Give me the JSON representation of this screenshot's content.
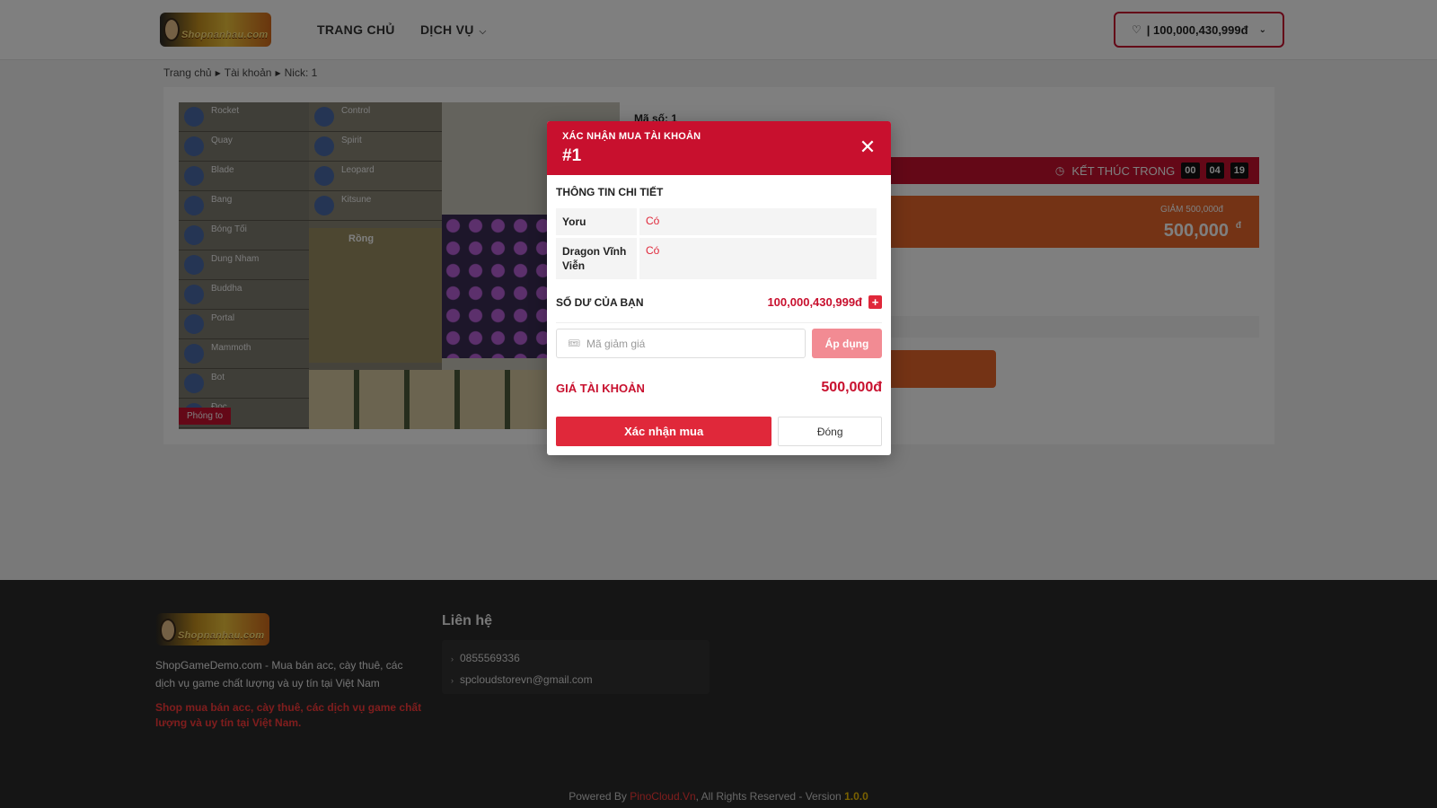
{
  "header": {
    "logo_text": "Shopnanhau.com",
    "nav": {
      "home": "TRANG CHỦ",
      "services": "DỊCH VỤ"
    },
    "balance": "| 100,000,430,999đ"
  },
  "breadcrumb": [
    "Trang chủ",
    "Tài khoản",
    "Nick: 1"
  ],
  "product": {
    "code_label": "Mã số: 1",
    "zoom_label": "Phóng to",
    "thumb_names_a": [
      "Rocket",
      "Quay",
      "Blade",
      "Bang",
      "Bóng Tối",
      "Dung Nham",
      "Buddha",
      "Portal",
      "Mammoth",
      "Bot",
      "Đọc"
    ],
    "thumb_names_b": [
      "Control",
      "Spirit",
      "Leopard",
      "Kitsune"
    ],
    "scene_label": "Rồng",
    "timer": {
      "label": "KẾT THÚC TRONG",
      "h": "00",
      "m": "04",
      "s": "19"
    },
    "discount_label": "GIẢM 500,000đ",
    "price": "500,000",
    "price_currency": "đ"
  },
  "modal": {
    "title": "XÁC NHẬN MUA TÀI KHOẢN",
    "number": "#1",
    "details_title": "THÔNG TIN CHI TIẾT",
    "details": [
      {
        "key": "Yoru",
        "value": "Có"
      },
      {
        "key": "Dragon Vĩnh Viễn",
        "value": "Có"
      }
    ],
    "balance_label": "SỐ DƯ CỦA BẠN",
    "balance_value": "100,000,430,999đ",
    "coupon_placeholder": "Mã giảm giá",
    "apply_label": "Áp dụng",
    "price_label": "GIÁ TÀI KHOẢN",
    "price_value": "500,000đ",
    "confirm_label": "Xác nhận mua",
    "close_label": "Đóng"
  },
  "footer": {
    "description": "ShopGameDemo.com - Mua bán acc, cày thuê, các dịch vụ game chất lượng và uy tín tại Việt Nam",
    "tagline": "Shop mua bán acc, cày thuê, các dịch vụ game chất lượng và uy tín tại Việt Nam.",
    "contact_title": "Liên hệ",
    "phone": "0855569336",
    "email": "spcloudstorevn@gmail.com",
    "powered_prefix": "Powered By ",
    "powered_brand": "PinoCloud.Vn",
    "powered_mid": ", All Rights Reserved - Version ",
    "version": "1.0.0"
  },
  "colors": {
    "primary_red": "#c8102e",
    "orange": "#e8662b",
    "footer_bg": "#2b2b2b"
  }
}
